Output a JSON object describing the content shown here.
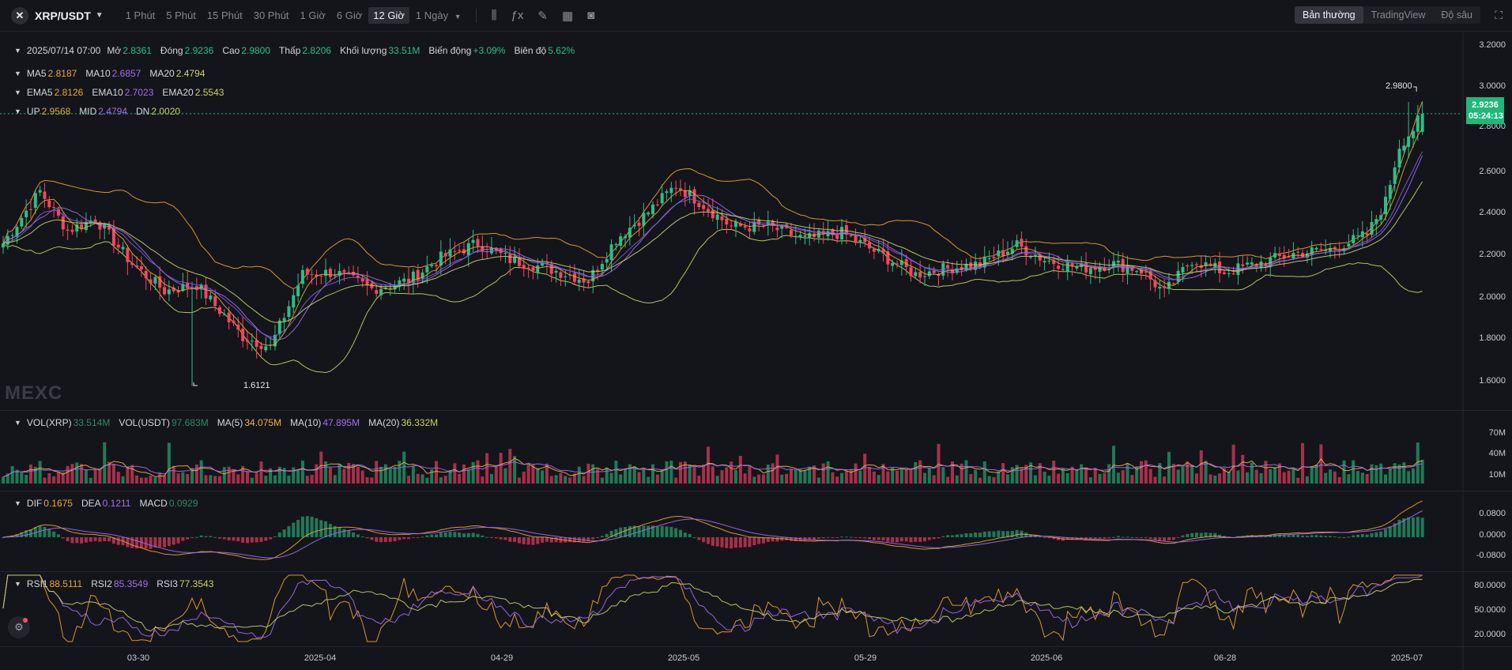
{
  "toolbar": {
    "logo_glyph": "✕",
    "symbol": "XRP/USDT",
    "intervals": [
      "1 Phút",
      "5 Phút",
      "15 Phút",
      "30 Phút",
      "1 Giờ",
      "6 Giờ",
      "12 Giờ",
      "1 Ngày"
    ],
    "active_interval": "12 Giờ",
    "tool_icons": [
      "candle-settings-icon",
      "indicator-fx-icon",
      "draw-pencil-icon",
      "layout-grid-icon",
      "camera-icon"
    ],
    "modes": [
      "Bản thường",
      "TradingView",
      "Độ sâu"
    ],
    "active_mode": "Bản thường"
  },
  "ohlc": {
    "date": "2025/07/14 07:00",
    "open_label": "Mở",
    "open": "2.8361",
    "close_label": "Đóng",
    "close": "2.9236",
    "high_label": "Cao",
    "high": "2.9800",
    "low_label": "Thấp",
    "low": "2.8206",
    "volume_label": "Khối lượng",
    "volume": "33.51M",
    "change_label": "Biến động",
    "change": "+3.09%",
    "amplitude_label": "Biên độ",
    "amplitude": "5.62%"
  },
  "ma": {
    "ma5_label": "MA5",
    "ma5": "2.8187",
    "ma10_label": "MA10",
    "ma10": "2.6857",
    "ma20_label": "MA20",
    "ma20": "2.4794"
  },
  "ema": {
    "ema5_label": "EMA5",
    "ema5": "2.8126",
    "ema10_label": "EMA10",
    "ema10": "2.7023",
    "ema20_label": "EMA20",
    "ema20": "2.5543"
  },
  "boll": {
    "up_label": "UP",
    "up": "2.9568",
    "mid_label": "MID",
    "mid": "2.4794",
    "dn_label": "DN",
    "dn": "2.0020"
  },
  "vol": {
    "vol_xrp_label": "VOL(XRP)",
    "vol_xrp": "33.514M",
    "vol_usdt_label": "VOL(USDT)",
    "vol_usdt": "97.683M",
    "ma5_label": "MA(5)",
    "ma5": "34.075M",
    "ma10_label": "MA(10)",
    "ma10": "47.895M",
    "ma20_label": "MA(20)",
    "ma20": "36.332M",
    "axis": [
      "70M",
      "40M",
      "10M"
    ]
  },
  "macd": {
    "dif_label": "DIF",
    "dif": "0.1675",
    "dea_label": "DEA",
    "dea": "0.1211",
    "macd_label": "MACD",
    "macd": "0.0929",
    "axis": [
      "0.0800",
      "0.0000",
      "-0.0800"
    ]
  },
  "rsi": {
    "rsi1_label": "RSI1",
    "rsi1": "88.5111",
    "rsi2_label": "RSI2",
    "rsi2": "85.3549",
    "rsi3_label": "RSI3",
    "rsi3": "77.3543",
    "axis": [
      "80.0000",
      "50.0000",
      "20.0000"
    ]
  },
  "price_axis": [
    "3.2000",
    "3.0000",
    "2.8000",
    "2.6000",
    "2.4000",
    "2.2000",
    "2.0000",
    "1.8000",
    "1.6000"
  ],
  "last_price": "2.9236",
  "countdown": "05:24:13",
  "high_marker": "2.9800",
  "low_marker": "1.6121",
  "x_axis": [
    "03-30",
    "2025-04",
    "04-29",
    "2025-05",
    "05-29",
    "2025-06",
    "06-28",
    "2025-07"
  ],
  "watermark": "MEXC",
  "colors": {
    "up": "#2ebd85",
    "down": "#f6465d",
    "ma5": "#e9a33a",
    "ma10": "#a26cf2",
    "ma20": "#c9d26a",
    "background": "#14151a"
  },
  "chart_data": {
    "type": "candlestick",
    "description_unit": "USDT",
    "price_ylim": [
      1.5,
      3.3
    ],
    "anchors": [
      {
        "i": 0,
        "c": 2.3
      },
      {
        "i": 8,
        "c": 2.55
      },
      {
        "i": 14,
        "c": 2.36
      },
      {
        "i": 20,
        "c": 2.42
      },
      {
        "i": 28,
        "c": 2.2
      },
      {
        "i": 35,
        "c": 2.07
      },
      {
        "i": 42,
        "c": 2.1
      },
      {
        "i": 52,
        "c": 1.85
      },
      {
        "i": 58,
        "c": 1.8
      },
      {
        "i": 65,
        "c": 2.15
      },
      {
        "i": 72,
        "c": 2.16
      },
      {
        "i": 80,
        "c": 2.08
      },
      {
        "i": 88,
        "c": 2.12
      },
      {
        "i": 95,
        "c": 2.23
      },
      {
        "i": 103,
        "c": 2.3
      },
      {
        "i": 110,
        "c": 2.22
      },
      {
        "i": 118,
        "c": 2.18
      },
      {
        "i": 127,
        "c": 2.12
      },
      {
        "i": 133,
        "c": 2.32
      },
      {
        "i": 140,
        "c": 2.45
      },
      {
        "i": 146,
        "c": 2.58
      },
      {
        "i": 151,
        "c": 2.5
      },
      {
        "i": 158,
        "c": 2.38
      },
      {
        "i": 166,
        "c": 2.38
      },
      {
        "i": 174,
        "c": 2.32
      },
      {
        "i": 182,
        "c": 2.35
      },
      {
        "i": 190,
        "c": 2.25
      },
      {
        "i": 198,
        "c": 2.15
      },
      {
        "i": 205,
        "c": 2.18
      },
      {
        "i": 212,
        "c": 2.2
      },
      {
        "i": 220,
        "c": 2.29
      },
      {
        "i": 226,
        "c": 2.22
      },
      {
        "i": 234,
        "c": 2.18
      },
      {
        "i": 241,
        "c": 2.2
      },
      {
        "i": 247,
        "c": 2.17
      },
      {
        "i": 252,
        "c": 2.06
      },
      {
        "i": 258,
        "c": 2.22
      },
      {
        "i": 265,
        "c": 2.16
      },
      {
        "i": 272,
        "c": 2.2
      },
      {
        "i": 280,
        "c": 2.25
      },
      {
        "i": 288,
        "c": 2.27
      },
      {
        "i": 296,
        "c": 2.34
      },
      {
        "i": 300,
        "c": 2.5
      },
      {
        "i": 303,
        "c": 2.77
      },
      {
        "i": 306,
        "c": 2.85
      },
      {
        "i": 308,
        "c": 2.9236
      }
    ],
    "macd_range": [
      -0.13,
      0.18
    ],
    "rsi_range": [
      0,
      100
    ],
    "vol_range_millions": [
      0,
      80
    ]
  }
}
